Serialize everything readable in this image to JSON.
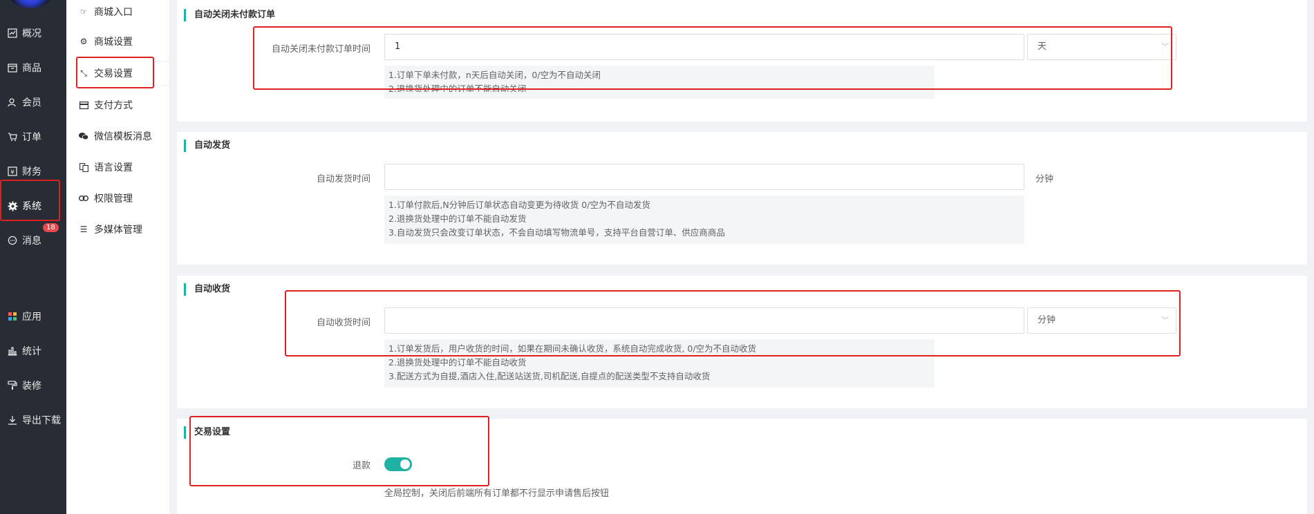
{
  "nav": {
    "items": [
      {
        "label": "概况",
        "icon": "chart-icon"
      },
      {
        "label": "商品",
        "icon": "box-icon"
      },
      {
        "label": "会员",
        "icon": "user-icon"
      },
      {
        "label": "订单",
        "icon": "cart-icon"
      },
      {
        "label": "财务",
        "icon": "yen-icon"
      },
      {
        "label": "系统",
        "icon": "gear-icon"
      },
      {
        "label": "消息",
        "icon": "message-icon"
      },
      {
        "label": "应用",
        "icon": "apps-icon"
      },
      {
        "label": "统计",
        "icon": "bar-chart-icon"
      },
      {
        "label": "装修",
        "icon": "paint-roller-icon"
      },
      {
        "label": "导出下载",
        "icon": "download-icon"
      }
    ],
    "message_badge": "18"
  },
  "submenu": {
    "items": [
      {
        "label": "商城入口",
        "icon": "thumb-icon"
      },
      {
        "label": "商城设置",
        "icon": "cog-icon"
      },
      {
        "label": "交易设置",
        "icon": "transfer-icon"
      },
      {
        "label": "支付方式",
        "icon": "card-icon"
      },
      {
        "label": "微信模板消息",
        "icon": "wechat-icon"
      },
      {
        "label": "语言设置",
        "icon": "translate-icon"
      },
      {
        "label": "权限管理",
        "icon": "link-icon"
      },
      {
        "label": "多媒体管理",
        "icon": "list-icon"
      }
    ]
  },
  "sections": {
    "auto_close": {
      "title": "自动关闭未付款订单",
      "label": "自动关闭未付款订单时间",
      "value": "1",
      "unit_select": "天",
      "tips": [
        "1.订单下单未付款，n天后自动关闭，0/空为不自动关闭",
        "2.退换货处理中的订单不能自动关闭"
      ]
    },
    "auto_ship": {
      "title": "自动发货",
      "label": "自动发货时间",
      "value": "",
      "unit": "分钟",
      "tips": [
        "1.订单付款后,N分钟后订单状态自动变更为待收货 0/空为不自动发货",
        "2.退换货处理中的订单不能自动发货",
        "3.自动发货只会改变订单状态，不会自动填写物流单号，支持平台自营订单、供应商商品"
      ]
    },
    "auto_receive": {
      "title": "自动收货",
      "label": "自动收货时间",
      "value": "",
      "unit_select": "分钟",
      "tips": [
        "1.订单发货后，用户收货的时间，如果在期间未确认收货，系统自动完成收货, 0/空为不自动收货",
        "2.退换货处理中的订单不能自动收货",
        "3.配送方式为自提,酒店入住,配送站送货,司机配送,自提点的配送类型不支持自动收货"
      ]
    },
    "trade": {
      "title": "交易设置",
      "refund_label": "退款",
      "refund_enabled": true,
      "refund_hint": "全局控制，关闭后前端所有订单都不行显示申请售后按钮"
    }
  },
  "colors": {
    "sidebar_bg": "#282c34",
    "accent": "#1fb1a2",
    "highlight_box": "#e02020",
    "badge": "#e5484d"
  }
}
